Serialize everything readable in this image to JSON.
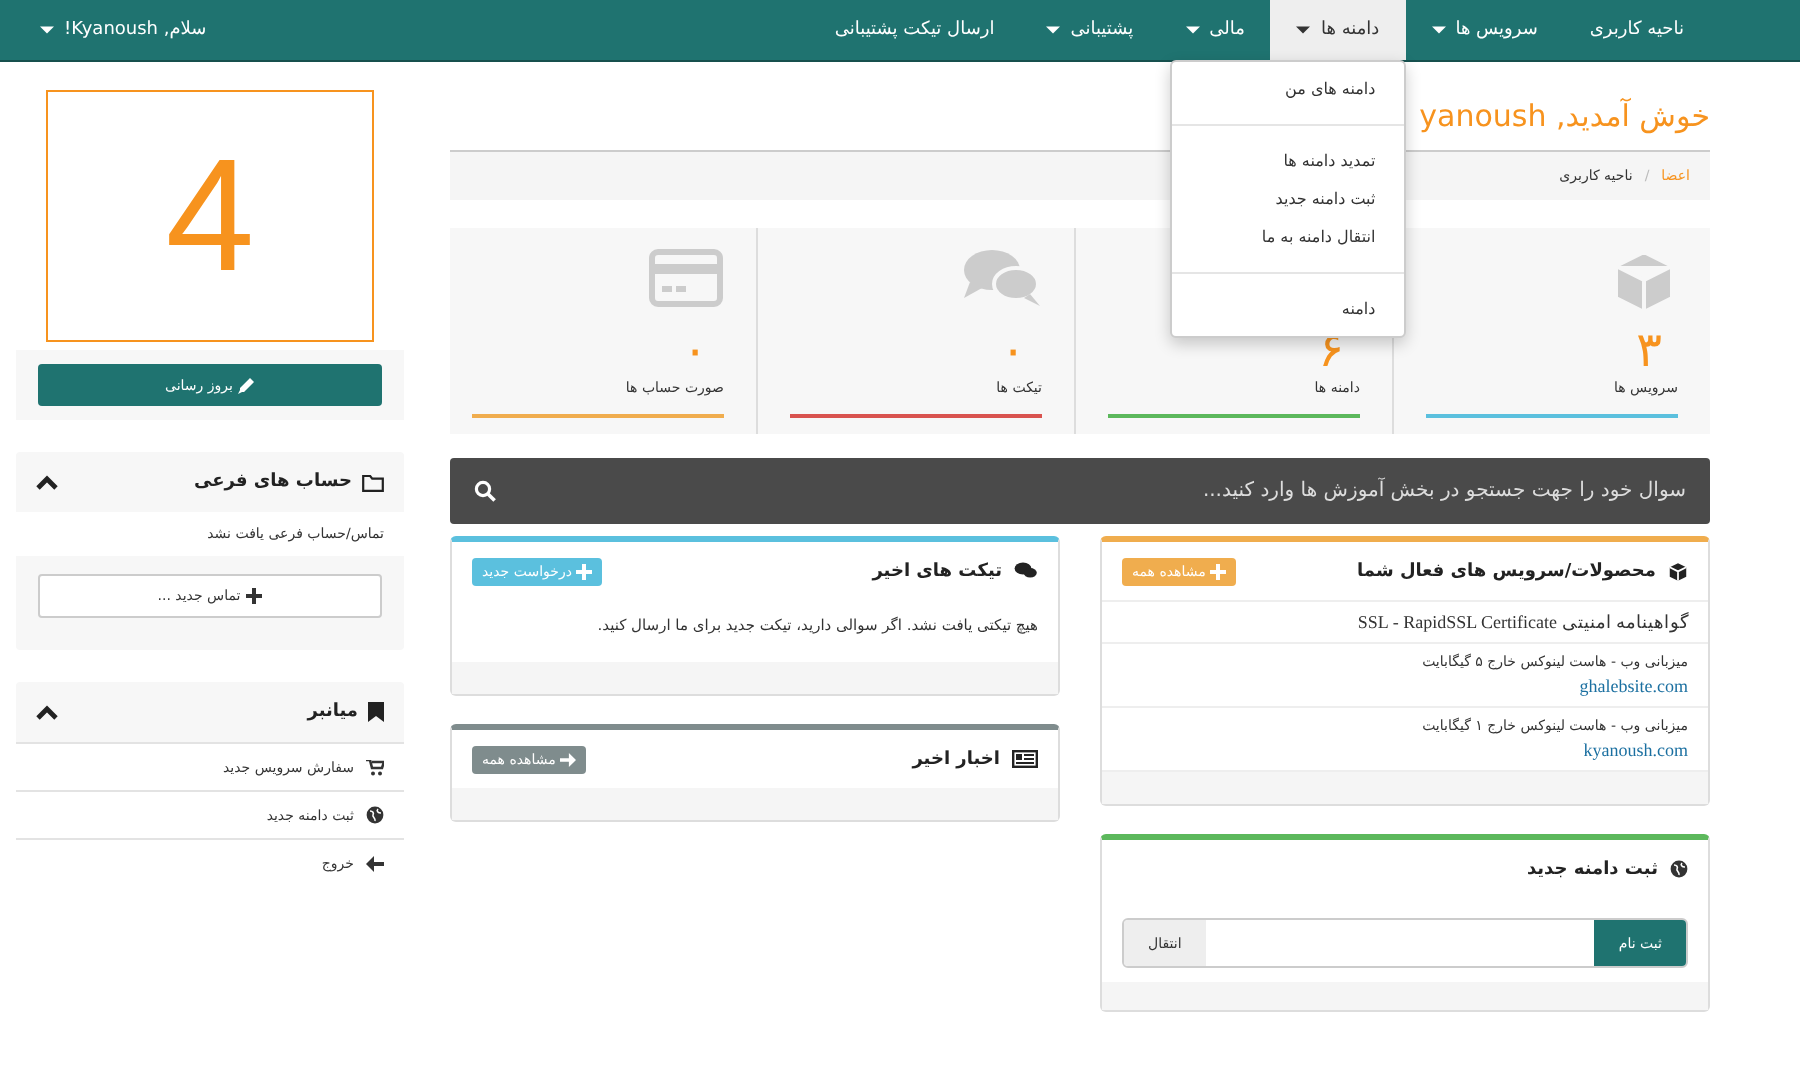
{
  "navbar": {
    "items": [
      {
        "label": "ناحیه کاربری",
        "has_caret": false,
        "selected": false
      },
      {
        "label": "سرویس ها",
        "has_caret": true,
        "selected": false
      },
      {
        "label": "دامنه ها",
        "has_caret": true,
        "selected": true
      },
      {
        "label": "مالی",
        "has_caret": true,
        "selected": false
      },
      {
        "label": "پشتیبانی",
        "has_caret": true,
        "selected": false
      },
      {
        "label": "ارسال تیکت پشتیبانی",
        "has_caret": false,
        "selected": false
      }
    ],
    "user_menu": "سلام, Kyanoush!"
  },
  "dropdown": {
    "items": [
      {
        "kind": "item",
        "label": "دامنه های من"
      },
      {
        "kind": "divider"
      },
      {
        "kind": "item",
        "label": "تمدید دامنه ها"
      },
      {
        "kind": "item",
        "label": "ثبت دامنه جدید"
      },
      {
        "kind": "item",
        "label": "انتقال دامنه به ما"
      },
      {
        "kind": "divider"
      },
      {
        "kind": "item",
        "label": "دامنه"
      }
    ]
  },
  "sidebar": {
    "big_number": "4",
    "update_button": "بروز رسانی",
    "subaccounts": {
      "title": "حساب های فرعی",
      "empty_text": "تماس/حساب فرعی یافت نشد",
      "button": "تماس جدید ..."
    },
    "shortcuts": {
      "title": "میانبر",
      "items": [
        {
          "kind": "cart",
          "label": "سفارش سرویس جدید"
        },
        {
          "kind": "globe",
          "label": "ثبت دامنه جدید"
        },
        {
          "kind": "logout",
          "label": "خروج"
        }
      ]
    }
  },
  "welcome": "خوش آمدید, yanoush",
  "breadcrumb": {
    "separator": "/",
    "items": [
      {
        "label": "اعضا",
        "link": true
      },
      {
        "label": "ناحیه کاربری",
        "link": false
      }
    ]
  },
  "stats": [
    {
      "kind": "services",
      "value": "۳",
      "label": "سرویس ها",
      "color": "#5bc0de"
    },
    {
      "kind": "domains",
      "value": "۶",
      "label": "دامنه ها",
      "color": "#5cb85c"
    },
    {
      "kind": "tickets",
      "value": "۰",
      "label": "تیکت ها",
      "color": "#d9534f"
    },
    {
      "kind": "invoices",
      "value": "۰",
      "label": "صورت حساب ها",
      "color": "#f0ad4e"
    }
  ],
  "search": {
    "placeholder": "سوال خود را جهت جستجو در بخش آموزش ها وارد کنید..."
  },
  "products": {
    "title": "محصولات/سرویس های فعال شما",
    "button": "مشاهده همه",
    "rows": [
      {
        "name": "گواهینامه امنیتی SSL - RapidSSL Certificate"
      },
      {
        "name": "میزبانی وب - هاست لینوکس خارج ۵ گیگابایت",
        "domain": "ghalebsite.com"
      },
      {
        "name": "میزبانی وب - هاست لینوکس خارج ۱ گیگابایت",
        "domain": "kyanoush.com"
      }
    ]
  },
  "tickets": {
    "title": "تیکت های اخیر",
    "button": "درخواست جدید",
    "text": "هیچ تیکتی یافت نشد. اگر سوالی دارید، تیکت جدید برای ما ارسال کنید."
  },
  "news": {
    "title": "اخبار اخیر",
    "button": "مشاهده همه"
  },
  "domain_register": {
    "title": "ثبت دامنه جدید",
    "buttons": [
      {
        "label": "ثبت نام",
        "selected": true
      },
      {
        "label": "انتقال",
        "selected": false
      }
    ]
  }
}
